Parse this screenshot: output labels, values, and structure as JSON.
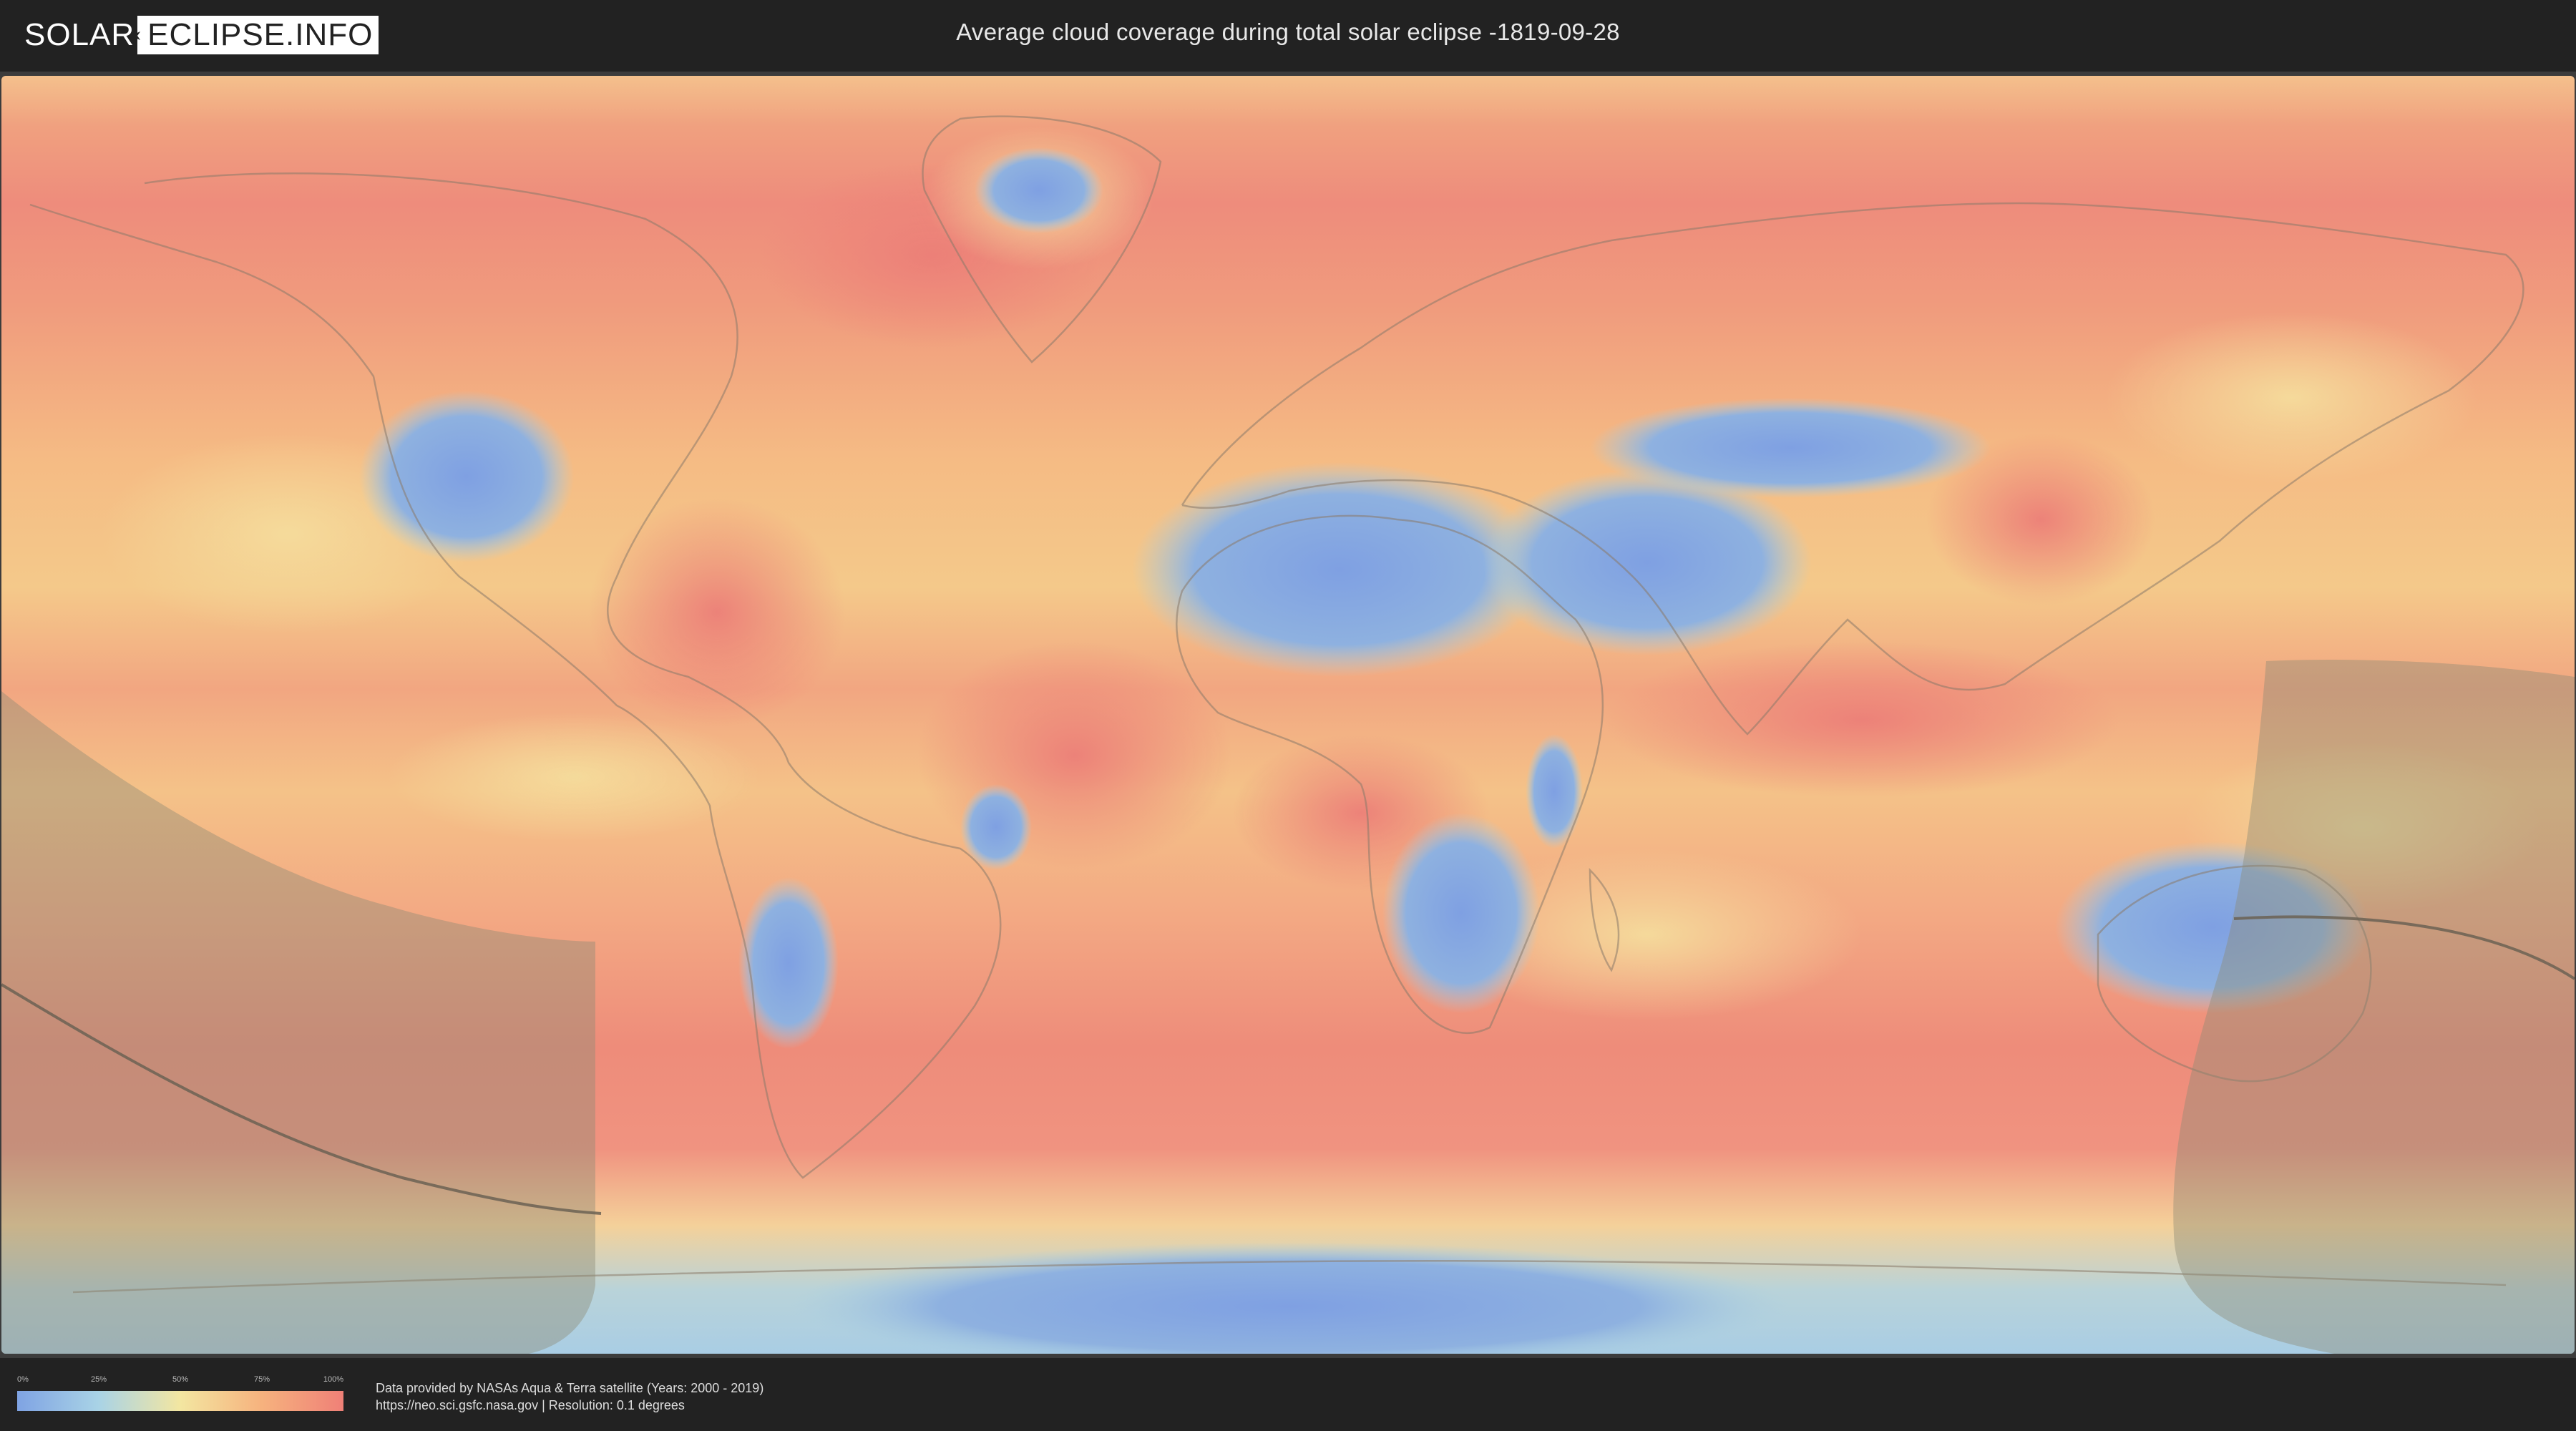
{
  "header": {
    "logo_part1": "SOLAR",
    "logo_part2": "ECLIPSE.INFO",
    "title": "Average cloud coverage during total solar eclipse -1819-09-28"
  },
  "map": {
    "layer": "cloud-coverage-raster",
    "eclipse_visibility_overlay": true,
    "central_line": true
  },
  "legend": {
    "ticks": [
      "0%",
      "25%",
      "50%",
      "75%",
      "100%"
    ],
    "colors": [
      "#7fa3e3",
      "#a9d3e6",
      "#f3e6a1",
      "#f6b27e",
      "#ef8077"
    ]
  },
  "footer": {
    "credit_line1": "Data provided by NASAs Aqua & Terra satellite (Years: 2000 - 2019)",
    "credit_line2": "https://neo.sci.gsfc.nasa.gov | Resolution: 0.1 degrees"
  }
}
